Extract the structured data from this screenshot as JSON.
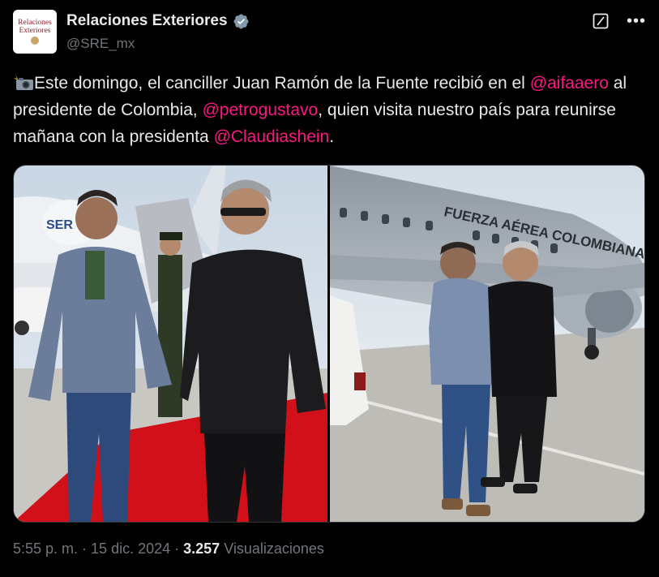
{
  "account": {
    "display_name": "Relaciones Exteriores",
    "handle": "@SRE_mx",
    "avatar_line1": "Relaciones",
    "avatar_line2": "Exteriores",
    "verified": true
  },
  "tweet": {
    "segments": [
      {
        "type": "text",
        "text": "Este domingo, el canciller Juan Ramón de la Fuente recibió en el "
      },
      {
        "type": "mention",
        "text": "@aifaaero"
      },
      {
        "type": "text",
        "text": " al presidente de Colombia, "
      },
      {
        "type": "mention",
        "text": "@petrogustavo"
      },
      {
        "type": "text",
        "text": ", quien visita nuestro país para reunirse mañana con la presidenta "
      },
      {
        "type": "mention",
        "text": "@Claudiashein"
      },
      {
        "type": "text",
        "text": "."
      }
    ],
    "emoji_icon": "camera-flash-icon"
  },
  "media": {
    "photos": [
      {
        "name": "photo-red-carpet",
        "plane_text": "SER"
      },
      {
        "name": "photo-airplane-embrace",
        "plane_text": "FUERZA AÉREA COLOMBIANA"
      }
    ]
  },
  "meta": {
    "time": "5:55 p. m.",
    "separator": " · ",
    "date": "15 dic. 2024",
    "views_count": "3.257",
    "views_label": "Visualizaciones"
  },
  "colors": {
    "background": "#000000",
    "text": "#e7e9ea",
    "secondary": "#71767b",
    "mention": "#f91880",
    "verified": "#829aab"
  }
}
